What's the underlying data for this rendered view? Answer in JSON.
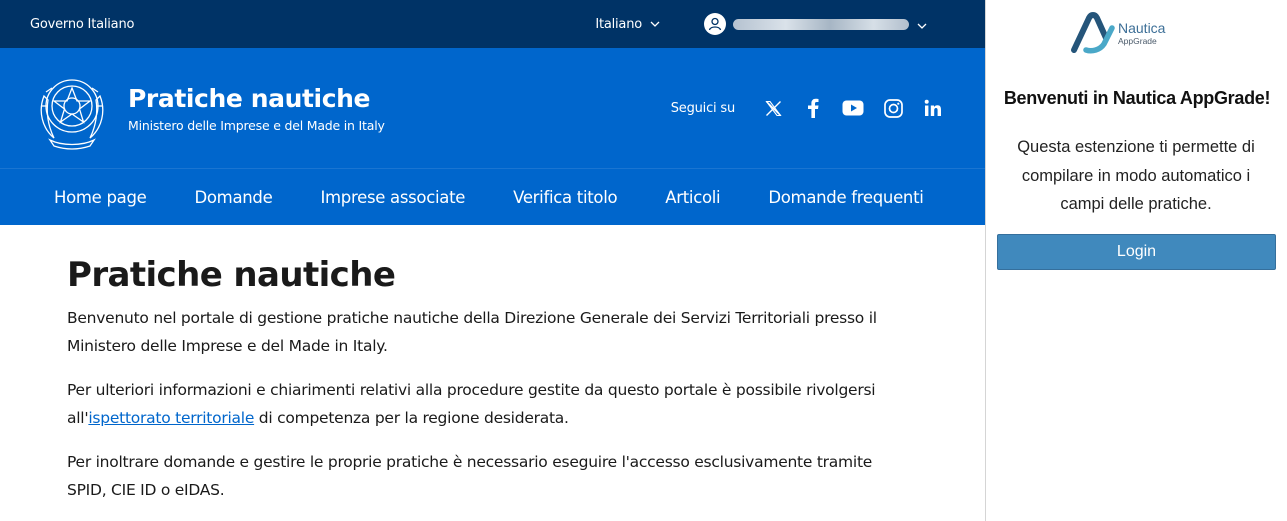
{
  "slim_header": {
    "government_label": "Governo Italiano",
    "language": {
      "selected": "Italiano",
      "icon": "chevron-down-icon"
    },
    "user": {
      "icon": "user-icon",
      "name_redacted": true,
      "menu_icon": "chevron-down-icon"
    }
  },
  "center_header": {
    "emblem": "italian-republic-emblem",
    "title": "Pratiche nautiche",
    "subtitle": "Ministero delle Imprese e del Made in Italy",
    "social": {
      "label": "Seguici su",
      "icons": [
        "x-icon",
        "facebook-icon",
        "youtube-icon",
        "instagram-icon",
        "linkedin-icon"
      ]
    }
  },
  "nav": {
    "items": [
      {
        "label": "Home page"
      },
      {
        "label": "Domande"
      },
      {
        "label": "Imprese associate"
      },
      {
        "label": "Verifica titolo"
      },
      {
        "label": "Articoli"
      },
      {
        "label": "Domande frequenti"
      }
    ]
  },
  "main": {
    "title": "Pratiche nautiche",
    "p1": "Benvenuto nel portale di gestione pratiche nautiche della Direzione Generale dei Servizi Territoriali presso il Ministero delle Imprese e del Made in Italy.",
    "p2_before": "Per ulteriori informazioni e chiarimenti relativi alla procedure gestite da questo portale è possibile rivolgersi all'",
    "p2_link": "ispettorato territoriale",
    "p2_after": " di competenza per la regione desiderata.",
    "p3": "Per inoltrare domande e gestire le proprie pratiche è necessario eseguire l'accesso esclusivamente tramite SPID, CIE ID o eIDAS."
  },
  "extension_panel": {
    "logo": {
      "name": "Nautica",
      "sub": "AppGrade"
    },
    "title": "Benvenuti in Nautica AppGrade!",
    "description": "Questa estenzione ti permette di compilare in modo automatico i campi delle pratiche.",
    "login_label": "Login"
  },
  "colors": {
    "slim_header_bg": "#003366",
    "header_bg": "#0066cc",
    "link": "#0066cc",
    "login_button": "#4089bd",
    "logo_accent": "#3d6f97"
  }
}
